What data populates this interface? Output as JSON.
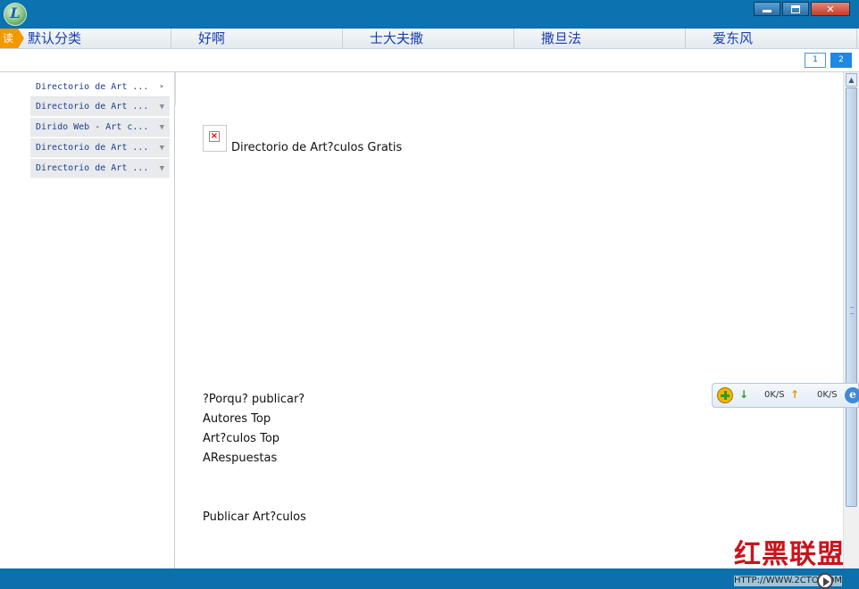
{
  "window": {
    "logo_letter": "L",
    "controls": {
      "minimize": "",
      "maximize": "",
      "close": "✕"
    }
  },
  "tabs": [
    {
      "label": "默认分类",
      "badge": "读"
    },
    {
      "label": "好啊"
    },
    {
      "label": "士大夫撒"
    },
    {
      "label": "撒旦法"
    },
    {
      "label": "爱东风"
    }
  ],
  "pager": {
    "pages": [
      "1",
      "2"
    ],
    "active": "2"
  },
  "sidebar": {
    "items": [
      {
        "label": "Directorio de Art  ...",
        "arrow": "➤"
      },
      {
        "label": "Directorio de Art  ...",
        "arrow": "▼"
      },
      {
        "label": "Dirido Web - Art  c...",
        "arrow": "▼"
      },
      {
        "label": "Directorio de Art  ...",
        "arrow": "▼"
      },
      {
        "label": "Directorio de Art  ...",
        "arrow": "▼"
      }
    ],
    "collapse_glyph": "◀"
  },
  "content": {
    "image_caption": "Directorio de Art?culos Gratis",
    "links": [
      "?Porqu? publicar?",
      "Autores Top",
      "Art?culos Top",
      "ARespuestas"
    ],
    "publish_link": "Publicar Art?culos"
  },
  "scrollbar": {
    "up_glyph": "▲"
  },
  "speed_widget": {
    "down_glyph": "↓",
    "download_speed": "0K/S",
    "up_glyph": "↑",
    "upload_speed": "0K/S",
    "ie_glyph": "e"
  },
  "watermark": {
    "brand": "红黑联盟",
    "url": "HTTP://WWW.2CTO.COM"
  },
  "colors": {
    "titlebar": "#0c72b0",
    "tab_text": "#1840b0",
    "badge": "#f39800",
    "statusbar": "#0d6fab",
    "watermark_red": "#c8141c"
  }
}
